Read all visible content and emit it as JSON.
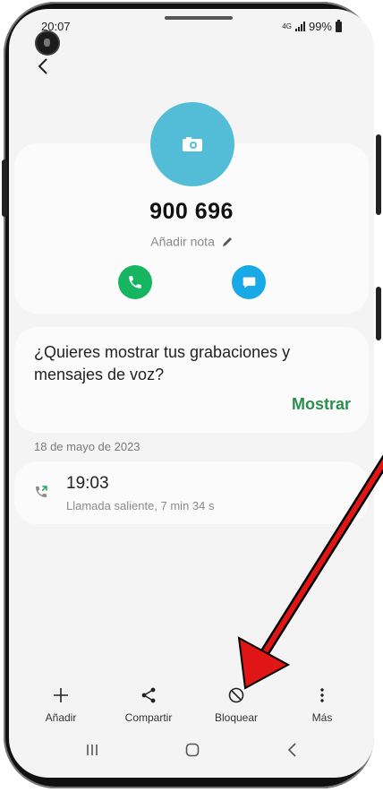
{
  "status_bar": {
    "time": "20:07",
    "network": "4G",
    "battery": "99%"
  },
  "contact": {
    "number": "900 696",
    "add_note": "Añadir nota"
  },
  "voice_prompt": {
    "text": "¿Quieres mostrar tus grabaciones y mensajes de voz?",
    "action": "Mostrar"
  },
  "history": {
    "date": "18 de mayo de 2023",
    "calls": [
      {
        "time": "19:03",
        "detail": "Llamada saliente, 7 min 34 s"
      }
    ]
  },
  "toolbar": {
    "add": "Añadir",
    "share": "Compartir",
    "block": "Bloquear",
    "more": "Más"
  },
  "icons": {
    "call_icon": "phone-icon",
    "message_icon": "message-icon",
    "avatar_icon": "camera-icon"
  },
  "colors": {
    "avatar": "#53bdd8",
    "call_button": "#16b562",
    "message_button": "#19a9e6",
    "accent_text": "#2a8f4c",
    "annotation_arrow": "#e01616"
  }
}
